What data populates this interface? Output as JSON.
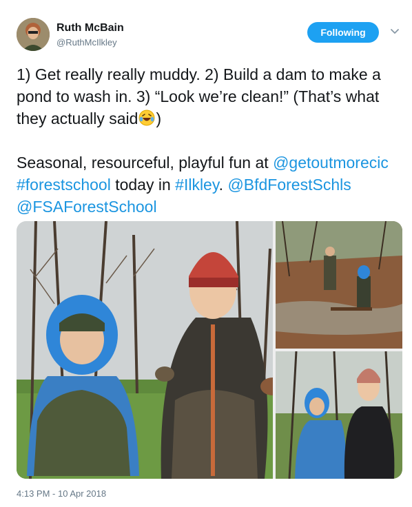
{
  "user": {
    "name": "Ruth McBain",
    "handle": "@RuthMcIlkley"
  },
  "follow_button": {
    "label": "Following"
  },
  "tweet": {
    "line1": "1) Get really really muddy. 2) Build a dam to make a pond to wash in. 3) “Look we’re clean!” (That’s what they actually said",
    "line1_end": ")",
    "p2_start": "Seasonal, resourceful, playful fun at ",
    "mention1": "@getoutmorecic",
    "hashtag1": "#forestschool",
    "p2_mid": " today in ",
    "hashtag2": "#Ilkley",
    "p2_dot": ". ",
    "mention2": "@BfdForestSchls",
    "mention3": "@FSAForestSchool"
  },
  "timestamp": "4:13 PM - 10 Apr 2018",
  "colors": {
    "accent": "#1da1f2",
    "link": "#1b95e0",
    "secondary_text": "#657786"
  },
  "icons": {
    "menu": "chevron-down-icon",
    "emoji": "rolling-on-floor-laughing-emoji"
  }
}
